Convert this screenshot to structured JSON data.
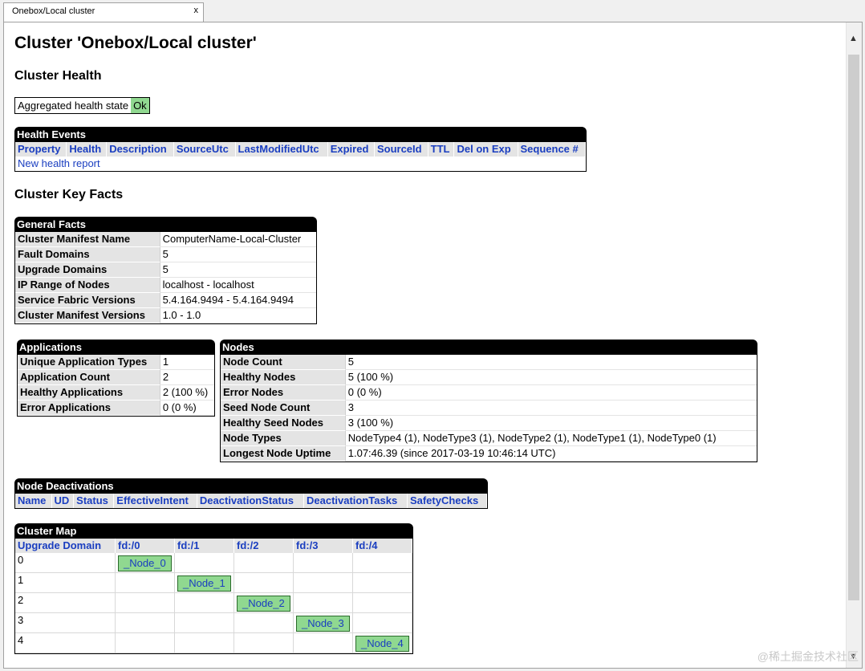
{
  "tab": {
    "title": "Onebox/Local cluster",
    "close": "x"
  },
  "page_title": "Cluster 'Onebox/Local cluster'",
  "health": {
    "heading": "Cluster Health",
    "label": "Aggregated health state",
    "value": "Ok"
  },
  "events": {
    "caption": "Health Events",
    "columns": [
      "Property",
      "Health",
      "Description",
      "SourceUtc",
      "LastModifiedUtc",
      "Expired",
      "SourceId",
      "TTL",
      "Del on Exp",
      "Sequence #"
    ],
    "new_report": "New health report"
  },
  "key_facts_heading": "Cluster Key Facts",
  "general": {
    "caption": "General Facts",
    "rows": [
      {
        "k": "Cluster Manifest Name",
        "v": "ComputerName-Local-Cluster"
      },
      {
        "k": "Fault Domains",
        "v": "5"
      },
      {
        "k": "Upgrade Domains",
        "v": "5"
      },
      {
        "k": "IP Range of Nodes",
        "v": "localhost - localhost"
      },
      {
        "k": "Service Fabric Versions",
        "v": "5.4.164.9494 - 5.4.164.9494"
      },
      {
        "k": "Cluster Manifest Versions",
        "v": "1.0 - 1.0"
      }
    ]
  },
  "applications": {
    "caption": "Applications",
    "rows": [
      {
        "k": "Unique Application Types",
        "v": "1"
      },
      {
        "k": "Application Count",
        "v": "2"
      },
      {
        "k": "Healthy Applications",
        "v": "2 (100 %)"
      },
      {
        "k": "Error Applications",
        "v": "0 (0 %)"
      }
    ]
  },
  "nodes": {
    "caption": "Nodes",
    "rows": [
      {
        "k": "Node Count",
        "v": "5"
      },
      {
        "k": "Healthy Nodes",
        "v": "5 (100 %)"
      },
      {
        "k": "Error Nodes",
        "v": "0 (0 %)"
      },
      {
        "k": "Seed Node Count",
        "v": "3"
      },
      {
        "k": "Healthy Seed Nodes",
        "v": "3 (100 %)"
      },
      {
        "k": "Node Types",
        "v": "NodeType4 (1), NodeType3 (1), NodeType2 (1), NodeType1 (1), NodeType0 (1)"
      },
      {
        "k": "Longest Node Uptime",
        "v": "1.07:46.39 (since 2017-03-19 10:46:14 UTC)"
      }
    ]
  },
  "deactivations": {
    "caption": "Node Deactivations",
    "columns": [
      "Name",
      "UD",
      "Status",
      "EffectiveIntent",
      "DeactivationStatus",
      "DeactivationTasks",
      "SafetyChecks"
    ]
  },
  "cluster_map": {
    "caption": "Cluster Map",
    "corner": "Upgrade Domain",
    "fault_domains": [
      "fd:/0",
      "fd:/1",
      "fd:/2",
      "fd:/3",
      "fd:/4"
    ],
    "upgrade_domains": [
      "0",
      "1",
      "2",
      "3",
      "4"
    ],
    "nodes": [
      "_Node_0",
      "_Node_1",
      "_Node_2",
      "_Node_3",
      "_Node_4"
    ]
  },
  "watermark": "@稀土掘金技术社区",
  "colors": {
    "ok_green": "#90d890",
    "link_blue": "#1a3ec0",
    "header_black": "#000000"
  }
}
